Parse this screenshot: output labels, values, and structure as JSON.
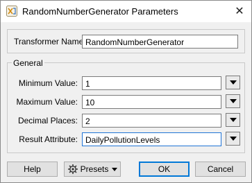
{
  "window": {
    "title": "RandomNumberGenerator Parameters",
    "close_glyph": "✕",
    "app_icon": "fme-transformer-icon"
  },
  "transformer": {
    "label": "Transformer Name:",
    "value": "RandomNumberGenerator"
  },
  "general": {
    "title": "General",
    "fields": [
      {
        "label": "Minimum Value:",
        "value": "1"
      },
      {
        "label": "Maximum Value:",
        "value": "10"
      },
      {
        "label": "Decimal Places:",
        "value": "2"
      },
      {
        "label": "Result Attribute:",
        "value": "DailyPollutionLevels"
      }
    ]
  },
  "buttons": {
    "help": "Help",
    "presets": "Presets",
    "ok": "OK",
    "cancel": "Cancel"
  },
  "colors": {
    "focus_border": "#1f74d6",
    "default_button_border": "#0078d7",
    "dialog_background": "#f0f0f0"
  }
}
